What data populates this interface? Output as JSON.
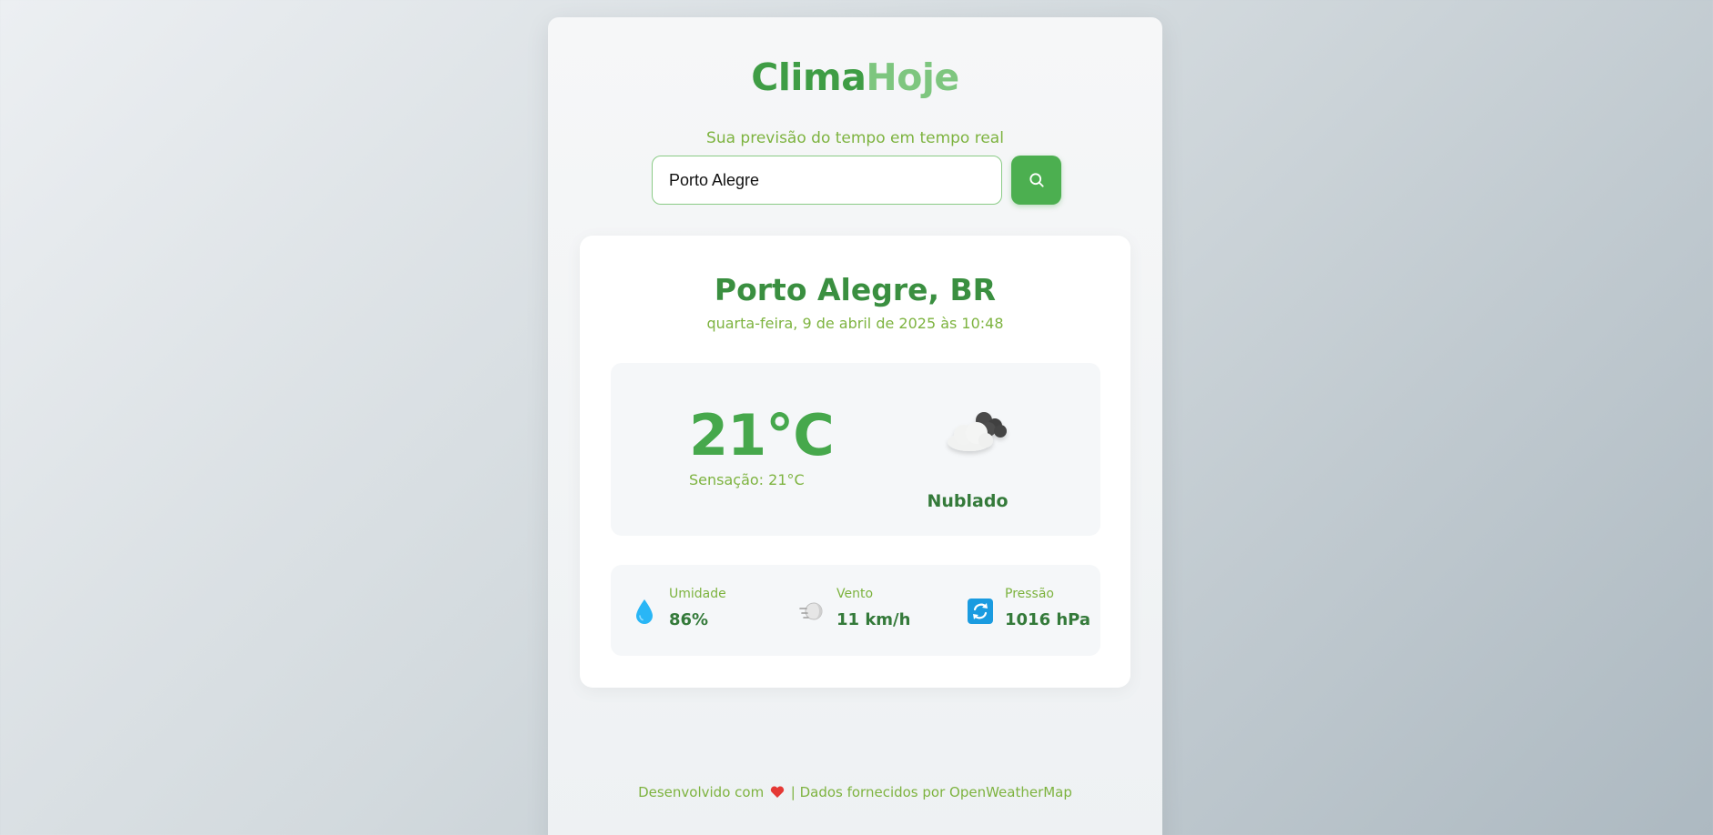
{
  "header": {
    "brand_part1": "Clima",
    "brand_part2": "Hoje",
    "subtitle": "Sua previsão do tempo em tempo real"
  },
  "search": {
    "value": "Porto Alegre",
    "button_icon": "search-icon"
  },
  "weather": {
    "city": "Porto Alegre, BR",
    "date": "quarta-feira, 9 de abril de 2025 às 10:48",
    "temperature": "21°C",
    "feels_like": "Sensação: 21°C",
    "condition_icon": "cloudy-icon",
    "description": "Nublado"
  },
  "stats": [
    {
      "icon": "droplet-icon",
      "label": "Umidade",
      "value": "86%"
    },
    {
      "icon": "wind-icon",
      "label": "Vento",
      "value": "11 km/h"
    },
    {
      "icon": "pressure-icon",
      "label": "Pressão",
      "value": "1016 hPa"
    }
  ],
  "footer": {
    "text_before": "Desenvolvido com",
    "heart_icon": "heart-icon",
    "text_after": "| Dados fornecidos por OpenWeatherMap"
  },
  "colors": {
    "primary": "#4caf50",
    "brand_dark": "#3f9d45",
    "brand_light": "#7ec67f",
    "secondary_text": "#7db33f"
  }
}
